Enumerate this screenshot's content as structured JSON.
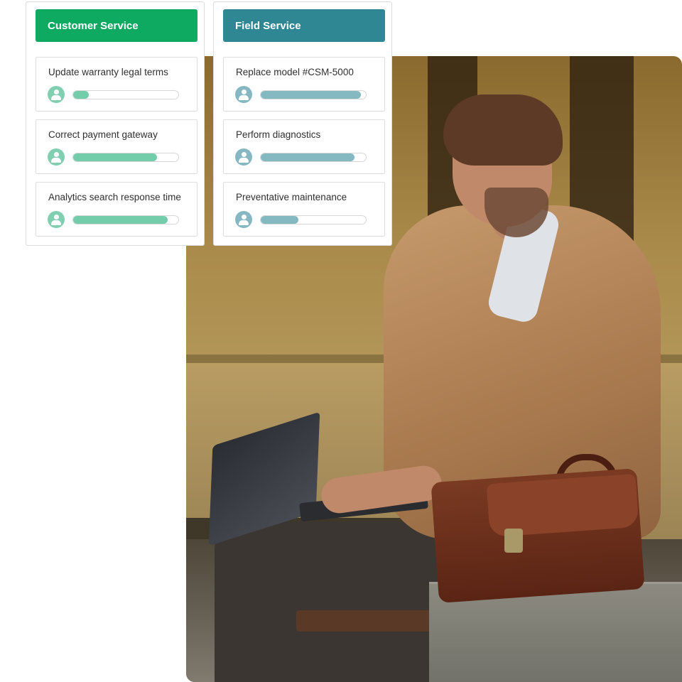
{
  "panels": [
    {
      "title": "Customer Service",
      "accent": "#0eaa62",
      "tasks": [
        {
          "label": "Update warranty legal terms",
          "progress": 0.15
        },
        {
          "label": "Correct payment gateway",
          "progress": 0.8
        },
        {
          "label": "Analytics search response time",
          "progress": 0.9
        }
      ]
    },
    {
      "title": "Field Service",
      "accent": "#2f8793",
      "tasks": [
        {
          "label": "Replace model #CSM-5000",
          "progress": 0.95
        },
        {
          "label": "Perform diagnostics",
          "progress": 0.89
        },
        {
          "label": "Preventative maintenance",
          "progress": 0.36
        }
      ]
    }
  ],
  "icons": {
    "assignee": "user-avatar-icon"
  }
}
